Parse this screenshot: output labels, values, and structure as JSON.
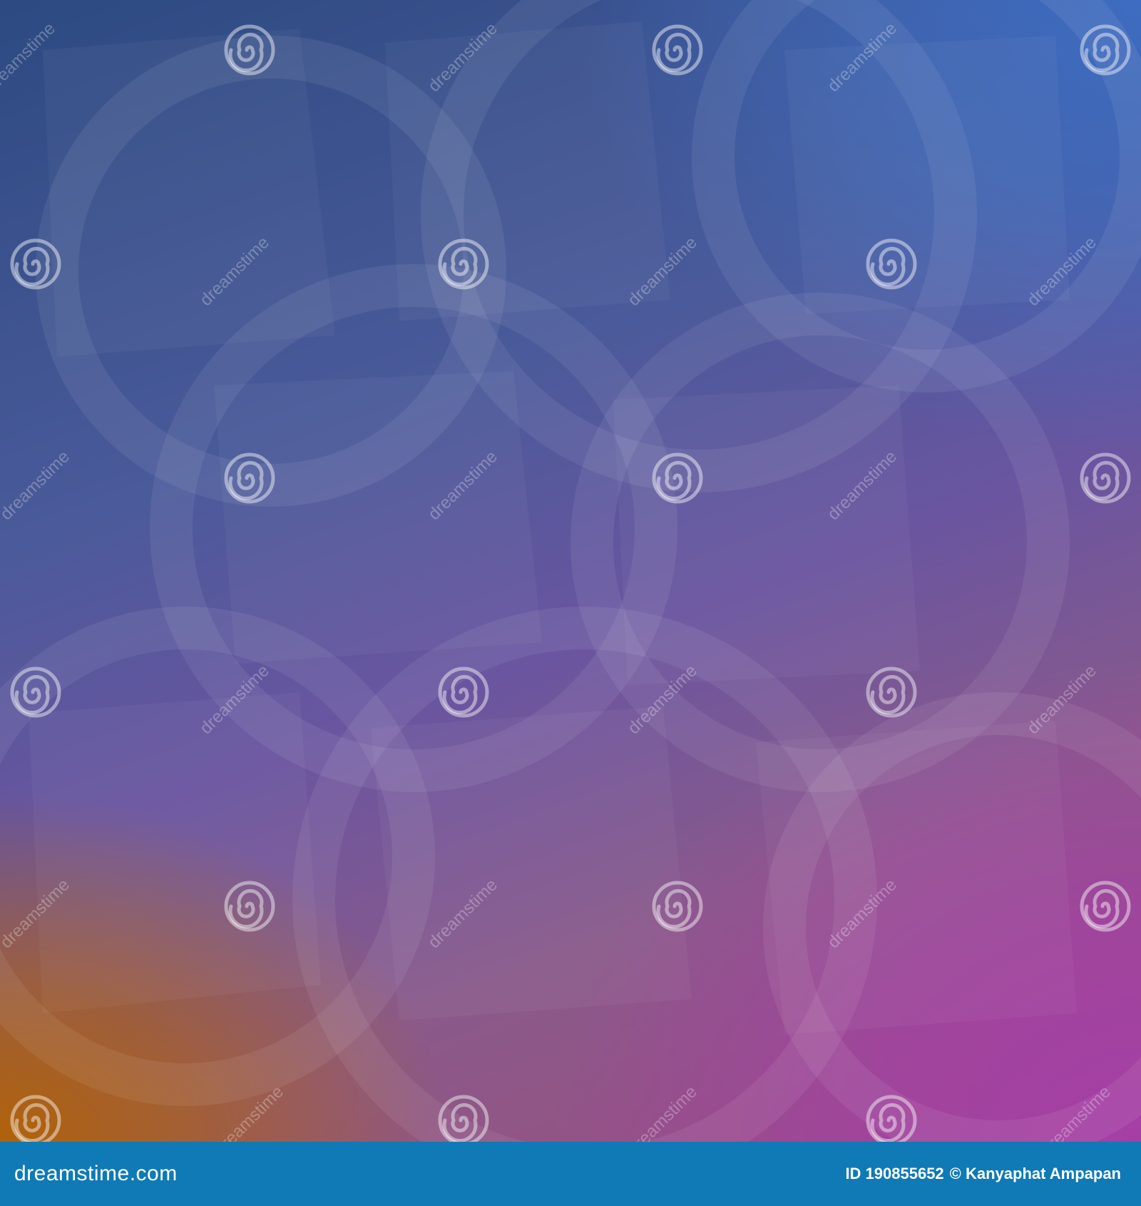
{
  "watermark": {
    "tile_text": "dreamstime",
    "logo_icon": "spiral-icon"
  },
  "footer": {
    "brand": "dreamstime.com",
    "id_label": "ID 190855652",
    "credit": "© Kanyaphat Ampapan"
  },
  "colors": {
    "footer_bar": "#0f7ab5",
    "top_left": "#2d4a82",
    "top_right": "#3e6cc0",
    "bottom_left": "#b0620a",
    "bottom_right": "#a53fa6"
  }
}
